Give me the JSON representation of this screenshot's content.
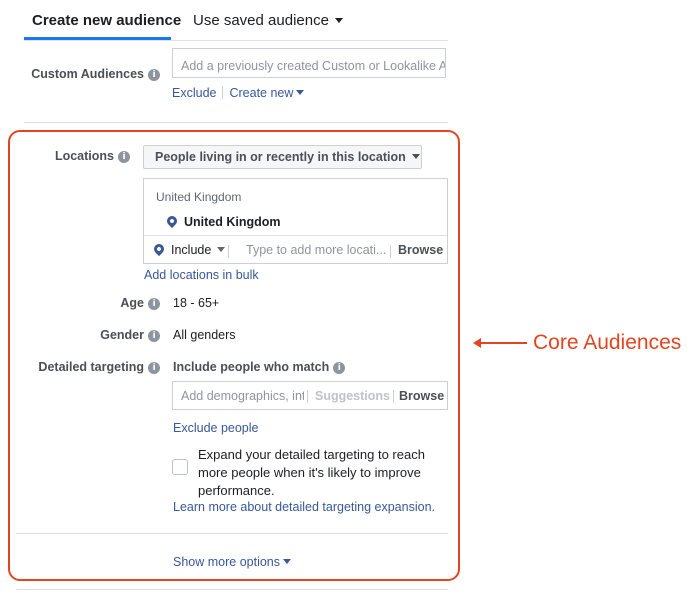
{
  "tabs": {
    "create_new": "Create new audience",
    "use_saved": "Use saved audience"
  },
  "custom_audiences": {
    "label": "Custom Audiences",
    "placeholder": "Add a previously created Custom or Lookalike A",
    "exclude": "Exclude",
    "create_new": "Create new"
  },
  "locations": {
    "label": "Locations",
    "dropdown": "People living in or recently in this location",
    "group_header": "United Kingdom",
    "selected": "United Kingdom",
    "include": "Include",
    "search_placeholder": "Type to add more locati...",
    "browse": "Browse",
    "bulk_link": "Add locations in bulk"
  },
  "age": {
    "label": "Age",
    "value": "18 - 65+"
  },
  "gender": {
    "label": "Gender",
    "value": "All genders"
  },
  "detailed_targeting": {
    "label": "Detailed targeting",
    "include_heading": "Include people who match",
    "placeholder": "Add demographics, int",
    "suggestions": "Suggestions",
    "browse": "Browse",
    "exclude_link": "Exclude people",
    "expand_text": "Expand your detailed targeting to reach more people when it's likely to improve performance.",
    "learn_more": "Learn more about detailed targeting expansion."
  },
  "show_more": "Show more options",
  "annotation": "Core Audiences",
  "colors": {
    "accent": "#1877f2",
    "link": "#385898",
    "annotation": "#e24521"
  },
  "icons": [
    "info-icon",
    "location-pin-icon",
    "caret-down-icon",
    "left-arrow-icon"
  ]
}
